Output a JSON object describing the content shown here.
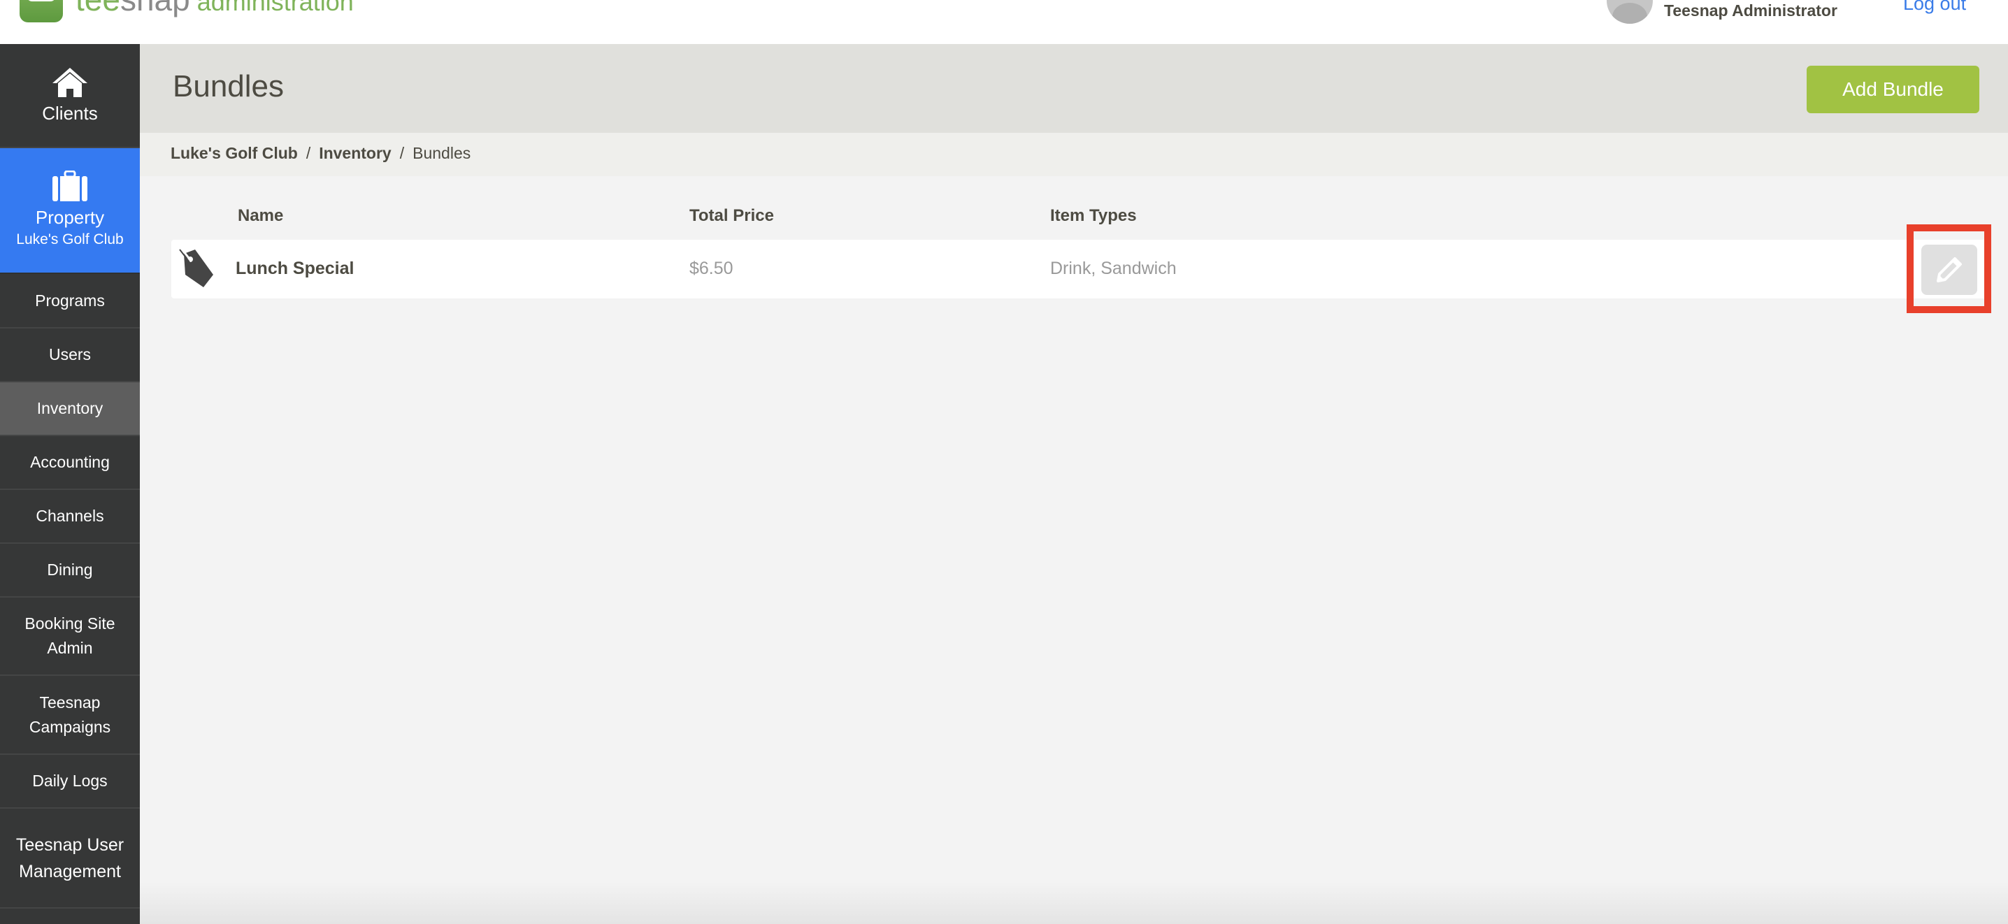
{
  "header": {
    "logo": {
      "word_part1": "tee",
      "word_part2": "snap",
      "suffix": "administration"
    },
    "user_name": "Teesnap Administrator",
    "logout_label": "Log out"
  },
  "sidebar": {
    "items": [
      {
        "label": "Clients",
        "icon": "home-icon"
      },
      {
        "label": "Property",
        "sublabel": "Luke's Golf Club",
        "icon": "briefcase-icon",
        "selected": true
      },
      {
        "label": "Programs"
      },
      {
        "label": "Users"
      },
      {
        "label": "Inventory",
        "active": true
      },
      {
        "label": "Accounting"
      },
      {
        "label": "Channels"
      },
      {
        "label": "Dining"
      },
      {
        "label": "Booking Site Admin"
      },
      {
        "label": "Teesnap Campaigns"
      },
      {
        "label": "Daily Logs"
      },
      {
        "label": "Teesnap User Management"
      }
    ]
  },
  "page": {
    "title": "Bundles",
    "add_button_label": "Add Bundle"
  },
  "breadcrumb": {
    "items": [
      "Luke's Golf Club",
      "Inventory"
    ],
    "current": "Bundles",
    "separator": "/"
  },
  "table": {
    "columns": [
      "Name",
      "Total Price",
      "Item Types"
    ],
    "rows": [
      {
        "icon": "price-tag-icon",
        "name": "Lunch Special",
        "total_price": "$6.50",
        "item_types": "Drink, Sandwich",
        "action": "edit"
      }
    ]
  },
  "colors": {
    "brand_green": "#7fb35a",
    "accent_blue": "#357af1",
    "add_button_green": "#a1c243",
    "highlight_red": "#e8402b",
    "sidebar_bg": "#363737"
  }
}
